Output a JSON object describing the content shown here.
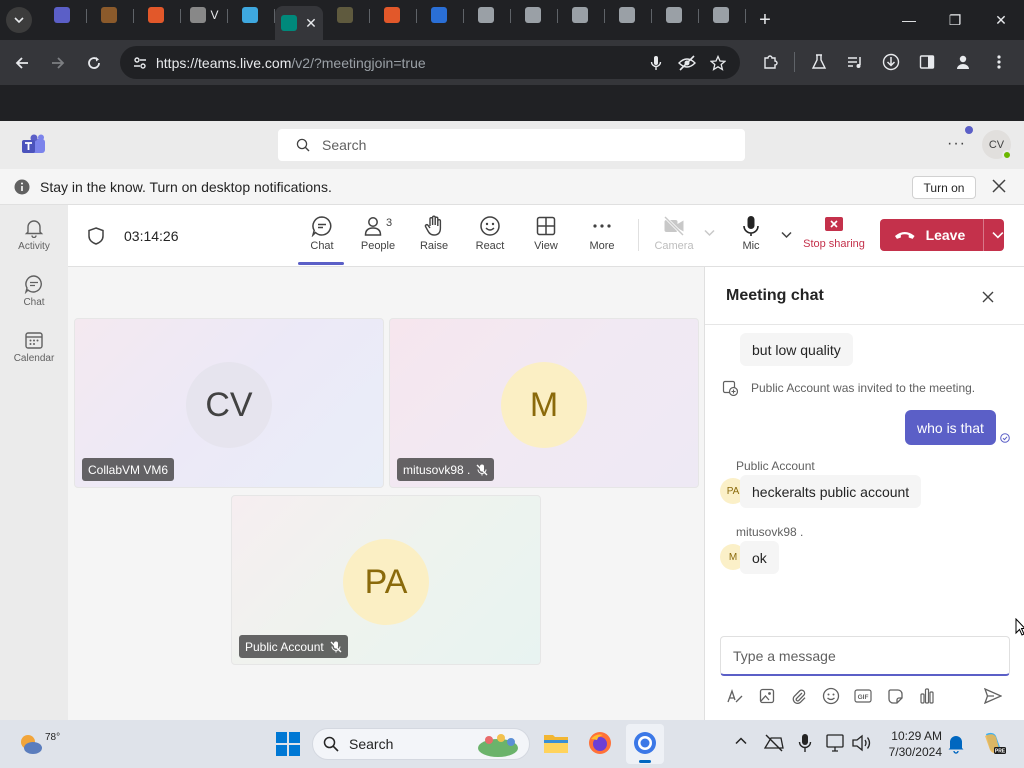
{
  "browser": {
    "tabs": [
      {
        "title": "",
        "color": "#5b5fc7"
      },
      {
        "title": "",
        "color": "#8b5a2b"
      },
      {
        "title": "",
        "color": "#e2582a"
      },
      {
        "title": "V",
        "color": "#888888"
      },
      {
        "title": "",
        "color": "#3ea8df"
      },
      {
        "title": "",
        "color": "#00897b"
      },
      {
        "title": "",
        "color": "#5f5a3e"
      },
      {
        "title": "",
        "color": "#e2582a"
      },
      {
        "title": "",
        "color": "#2a6fd6"
      },
      {
        "title": "",
        "color": "#9aa0a6"
      },
      {
        "title": "",
        "color": "#9aa0a6"
      },
      {
        "title": "",
        "color": "#9aa0a6"
      },
      {
        "title": "",
        "color": "#9aa0a6"
      },
      {
        "title": "",
        "color": "#9aa0a6"
      },
      {
        "title": "",
        "color": "#9aa0a6"
      }
    ],
    "url_host": "https://teams.live.com",
    "url_path": "/v2/?meetingjoin=true"
  },
  "teams": {
    "search_placeholder": "Search",
    "user_initials": "CV",
    "notification_text": "Stay in the know. Turn on desktop notifications.",
    "turn_on_label": "Turn on",
    "rail": [
      {
        "label": "Activity",
        "icon": "bell-icon"
      },
      {
        "label": "Chat",
        "icon": "chat-icon"
      },
      {
        "label": "Calendar",
        "icon": "calendar-icon"
      }
    ]
  },
  "meeting": {
    "timer": "03:14:26",
    "people_count": "3",
    "buttons": {
      "chat": "Chat",
      "people": "People",
      "raise": "Raise",
      "react": "React",
      "view": "View",
      "more": "More",
      "camera": "Camera",
      "mic": "Mic",
      "stop_sharing": "Stop sharing",
      "leave": "Leave"
    },
    "participants": [
      {
        "initials": "CV",
        "name": "CollabVM VM6",
        "muted": false
      },
      {
        "initials": "M",
        "name": "mitusovk98 .",
        "muted": true
      },
      {
        "initials": "PA",
        "name": "Public Account",
        "muted": true
      }
    ]
  },
  "chat": {
    "title": "Meeting chat",
    "messages": {
      "m1_text": "but low quality",
      "system_text": "Public Account was invited to the meeting.",
      "m2_text": "who is that",
      "m3_sender": "Public Account",
      "m3_initials": "PA",
      "m3_text": "heckeralts public account",
      "m4_sender": "mitusovk98 .",
      "m4_initials": "M",
      "m4_text": "ok"
    },
    "compose_placeholder": "Type a message"
  },
  "taskbar": {
    "weather_temp": "78°",
    "search_label": "Search",
    "time": "10:29 AM",
    "date": "7/30/2024"
  },
  "colors": {
    "brand": "#5b5fc7",
    "leave": "#c4314b",
    "stop_sharing": "#c4314b"
  }
}
